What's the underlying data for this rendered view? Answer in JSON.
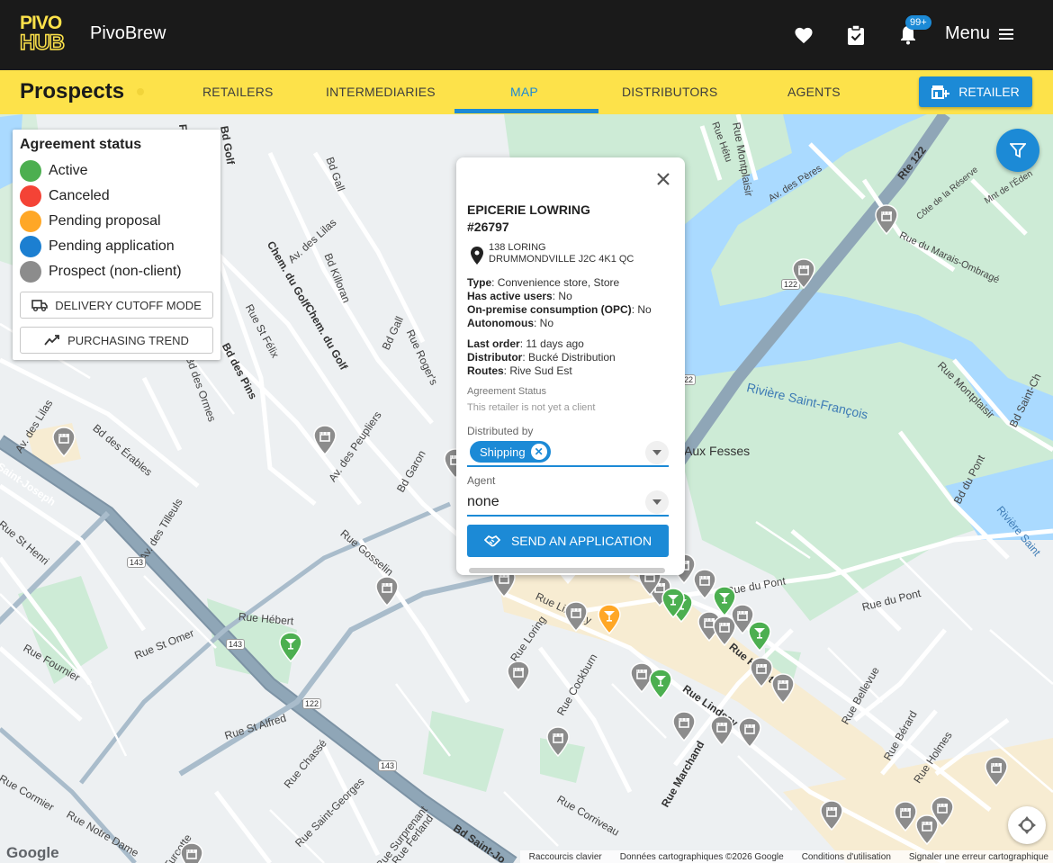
{
  "header": {
    "logo_text_top": "PIVO",
    "logo_text_bottom": "HUB",
    "app_name": "PivoBrew",
    "notification_badge": "99+",
    "menu_label": "Menu"
  },
  "nav": {
    "page_title": "Prospects",
    "tabs": [
      {
        "label": "RETAILERS"
      },
      {
        "label": "INTERMEDIARIES"
      },
      {
        "label": "MAP"
      },
      {
        "label": "DISTRIBUTORS"
      },
      {
        "label": "AGENTS"
      }
    ],
    "active_tab": "MAP",
    "add_retailer_label": "RETAILER"
  },
  "legend": {
    "title": "Agreement status",
    "items": [
      {
        "label": "Active",
        "color": "#4caf50"
      },
      {
        "label": "Canceled",
        "color": "#f44336"
      },
      {
        "label": "Pending proposal",
        "color": "#ffa726"
      },
      {
        "label": "Pending application",
        "color": "#1c7fd1"
      },
      {
        "label": "Prospect (non-client)",
        "color": "#8c8c8c"
      }
    ],
    "delivery_cutoff_label": "DELIVERY CUTOFF MODE",
    "purchasing_trend_label": "PURCHASING TREND"
  },
  "popup": {
    "name": "EPICERIE LOWRING",
    "number": "#26797",
    "address_line1": "138 LORING",
    "address_line2": "DRUMMONDVILLE J2C 4K1 QC",
    "type_label": "Type",
    "type_value": ": Convenience store, Store",
    "active_users_label": "Has active users",
    "active_users_value": ": No",
    "opc_label": "On-premise consumption (OPC)",
    "opc_value": ": No",
    "autonomous_label": "Autonomous",
    "autonomous_value": ": No",
    "last_order_label": "Last order",
    "last_order_value": ": 11 days ago",
    "distributor_label": "Distributor",
    "distributor_value": ": Bucké Distribution",
    "routes_label": "Routes",
    "routes_value": ": Rive Sud Est",
    "agreement_status_label": "Agreement Status",
    "agreement_status_value": "This retailer is not yet a client",
    "distributed_by_label": "Distributed by",
    "distributed_by_chip": "Shipping",
    "agent_label": "Agent",
    "agent_value": "none",
    "send_button": "SEND AN APPLICATION"
  },
  "map_labels": {
    "roads": [
      "Rue Montplaisir",
      "Rte 122",
      "Av. des Pères",
      "Côte de la Réserve",
      "Mnt de l'Éden",
      "Rue du Marais-Ombragé",
      "Rivière Saint-François",
      "Rue Montplaisir",
      "Bd Saint-Ch",
      "Bd du Pont",
      "Rue du Pont",
      "Rue du Pont",
      "Rivière Saint",
      "Bd Gall",
      "Av. des Lilas",
      "Bd Killoran",
      "Chem. du Golf",
      "Chem. du Golf",
      "Rue St Félix",
      "Bd des Pins",
      "Bd Gall",
      "Rue Roger's",
      "Bd des Ormes",
      "Av. des Lilas",
      "Bd des Érables",
      "Av. des Peupliers",
      "Bd Garon",
      "Rue Gosselin",
      "Av. des Tilleuls",
      "Saint-Joseph",
      "Rue St Henri",
      "Rue Hébert",
      "Rue St Omer",
      "Rue Fournier",
      "Rue St Alfred",
      "Rue Chassé",
      "Rue Saint-Georges",
      "Rue Surprenant",
      "Rue Ferland",
      "Bd Saint-Jo",
      "Rue Notre Dame",
      "Rue Cormier",
      "Turcotte",
      "Rue Loring",
      "Rue Lindsay",
      "Rue Cockburn",
      "Rue Corriveau",
      "Rue Marchand",
      "Rue Lindsay",
      "Rue Hériot",
      "Rue Bellevue",
      "Rue Bérard",
      "Rue Holmes",
      "Aux Fesses",
      "Bd Golf",
      "Fél",
      "Rue Hétu"
    ],
    "route_shields": [
      "143",
      "143",
      "122",
      "143",
      "122",
      "122"
    ]
  },
  "map_footer": {
    "google": "Google",
    "shortcuts": "Raccourcis clavier",
    "map_data": "Données cartographiques ©2026 Google",
    "terms": "Conditions d'utilisation",
    "report": "Signaler une erreur cartographique"
  },
  "markers": [
    {
      "kind": "store",
      "color": "#8c8c8c"
    },
    {
      "kind": "bar",
      "color": "#4caf50"
    },
    {
      "kind": "bar",
      "color": "#ffa726"
    }
  ]
}
